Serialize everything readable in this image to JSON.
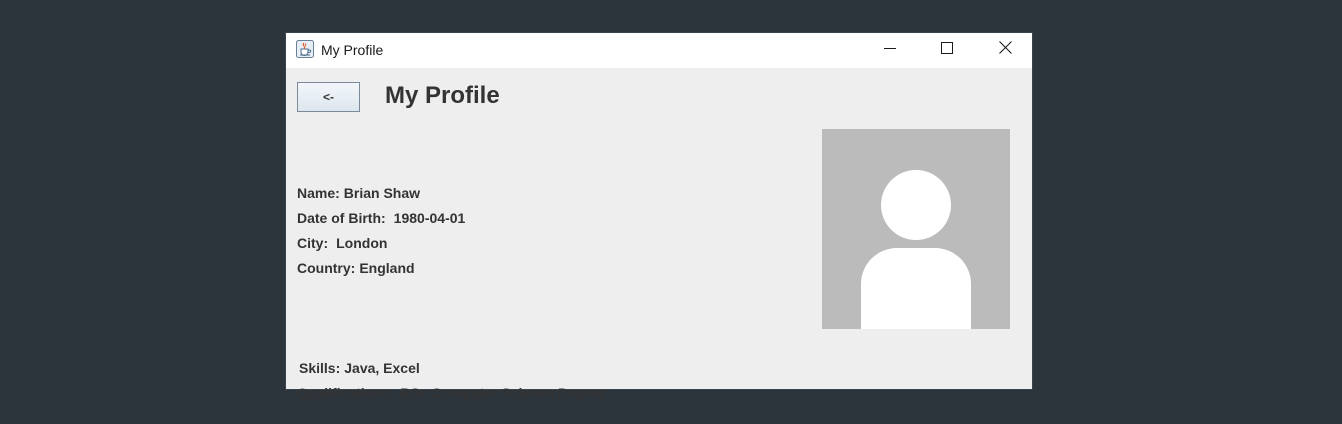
{
  "window": {
    "title": "My Profile",
    "app_icon": "java-cup-icon",
    "controls": {
      "minimize_icon": "minimize-icon",
      "maximize_icon": "maximize-icon",
      "close_icon": "close-icon"
    }
  },
  "header": {
    "back_label": "<-",
    "page_title": "My Profile"
  },
  "profile": {
    "name_label": "Name:",
    "name_value": "Brian Shaw",
    "dob_label": "Date of Birth:",
    "dob_value": "1980-04-01",
    "city_label": "City:",
    "city_value": "London",
    "country_label": "Country:",
    "country_value": "England",
    "skills_label": "Skills:",
    "skills_value": "Java, Excel",
    "qualifications_label": "Qualifications:",
    "qualifications_value": "BSc Computer Science Degree"
  },
  "avatar": {
    "icon": "user-placeholder-icon",
    "background_color": "#bbbbbb",
    "figure_color": "#ffffff"
  }
}
